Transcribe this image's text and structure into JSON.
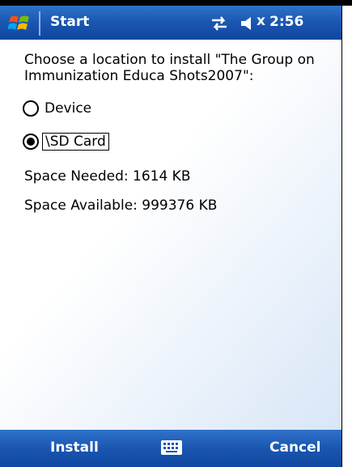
{
  "titlebar": {
    "title": "Start",
    "clock": "2:56",
    "mute": "x"
  },
  "install_dialog": {
    "prompt": "Choose a location to install \"The Group on Immunization Educa Shots2007\":",
    "options": [
      {
        "label": "Device",
        "selected": false
      },
      {
        "label": "\\SD Card",
        "selected": true
      }
    ],
    "space_needed": "Space Needed:  1614 KB",
    "space_available": "Space Available: 999376 KB"
  },
  "menubar": {
    "left_softkey": "Install",
    "right_softkey": "Cancel"
  },
  "icons": [
    "windows-start-icon",
    "sync-icon",
    "speaker-icon",
    "keyboard-icon"
  ],
  "colors": {
    "bar_blue": "#1a56b0",
    "bar_highlight": "#2f73c9",
    "content_tint": "#d8e6f7"
  }
}
